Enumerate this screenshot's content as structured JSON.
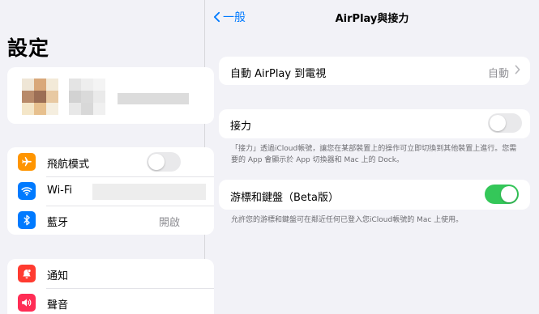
{
  "sidebar": {
    "title": "設定",
    "group1": [
      {
        "label": "飛航模式",
        "icon": "airplane-icon",
        "color": "#ff9500",
        "toggle": false
      },
      {
        "label": "Wi-Fi",
        "icon": "wifi-icon",
        "color": "#007aff"
      },
      {
        "label": "藍牙",
        "icon": "bluetooth-icon",
        "color": "#007aff",
        "value": "開啟"
      }
    ],
    "group2": [
      {
        "label": "通知",
        "icon": "bell-icon",
        "color": "#ff3b30"
      },
      {
        "label": "聲音",
        "icon": "speaker-icon",
        "color": "#ff2d55"
      }
    ]
  },
  "main": {
    "back_label": "一般",
    "title": "AirPlay與接力",
    "auto_airplay": {
      "label": "自動 AirPlay 到電視",
      "value": "自動"
    },
    "handoff": {
      "label": "接力",
      "toggle": false,
      "footnote": "「接力」透過iCloud帳號，讓您在某部裝置上的操作可立即切換到其他裝置上進行。您需要的 App 會顯示於 App 切換器和 Mac 上的 Dock。"
    },
    "cursor": {
      "label": "游標和鍵盤（Beta版）",
      "toggle": true,
      "footnote": "允許您的游標和鍵盤可在鄰近任何已登入您iCloud帳號的 Mac 上使用。"
    }
  }
}
